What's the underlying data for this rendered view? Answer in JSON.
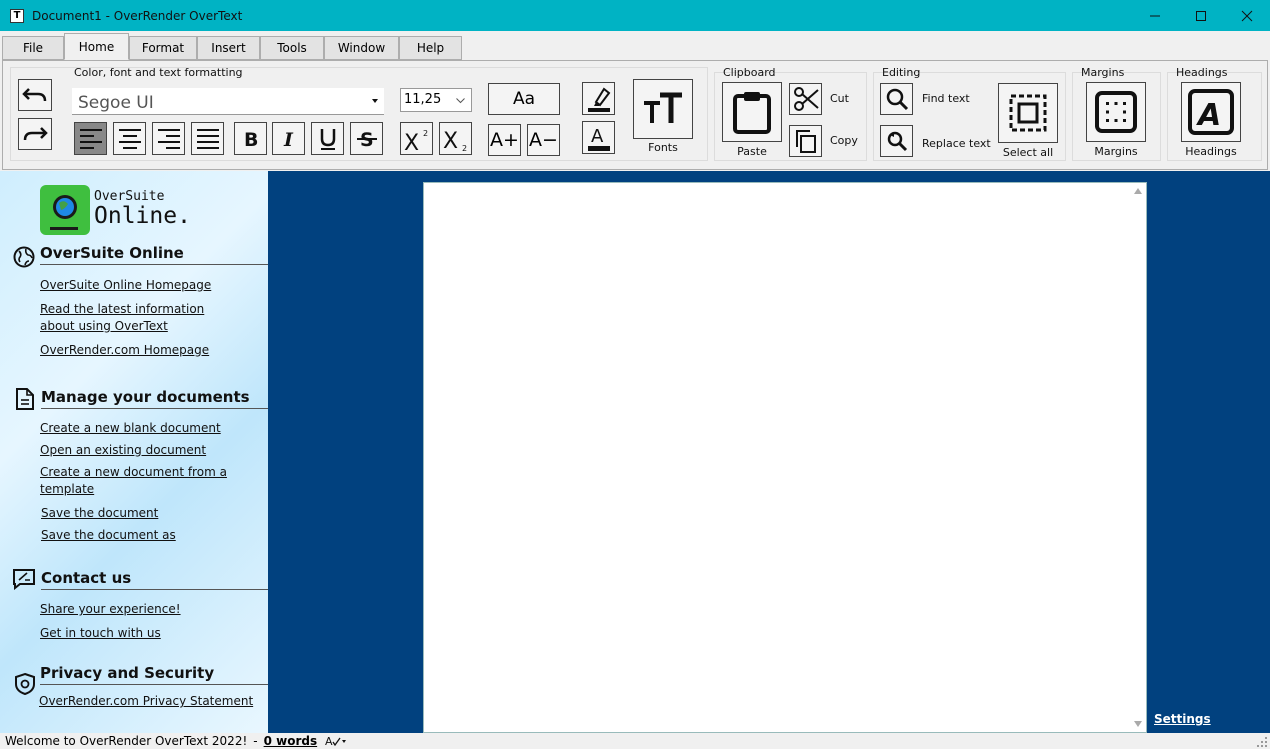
{
  "window": {
    "title": "Document1 - OverRender OverText",
    "app_icon_letter": "T"
  },
  "menu": {
    "tabs": [
      "File",
      "Home",
      "Format",
      "Insert",
      "Tools",
      "Window",
      "Help"
    ],
    "active": "Home"
  },
  "ribbon": {
    "formatting_group_title": "Color, font and text formatting",
    "font_name": "Segoe UI",
    "font_size": "11,25",
    "change_case_label": "Aa",
    "grow_font_label": "A+",
    "shrink_font_label": "A−",
    "fonts_label": "Fonts",
    "clipboard": {
      "title": "Clipboard",
      "paste": "Paste",
      "cut": "Cut",
      "copy": "Copy"
    },
    "editing": {
      "title": "Editing",
      "find": "Find text",
      "replace": "Replace text",
      "select_all": "Select all"
    },
    "margins": {
      "title": "Margins",
      "button": "Margins"
    },
    "headings": {
      "title": "Headings",
      "button": "Headings"
    }
  },
  "sidebar": {
    "logo_line1": "OverSuite",
    "logo_line2": "Online.",
    "sections": [
      {
        "heading": "OverSuite Online",
        "icon": "globe-icon",
        "links": [
          "OverSuite Online Homepage",
          "Read the latest information about using OverText",
          "OverRender.com Homepage"
        ]
      },
      {
        "heading": "Manage your documents",
        "icon": "document-icon",
        "links": [
          "Create a new blank document",
          "Open an existing document",
          "Create a new document from a template",
          "Save the document",
          "Save the document as"
        ]
      },
      {
        "heading": "Contact us",
        "icon": "feedback-icon",
        "links": [
          "Share your experience!",
          "Get in touch with us"
        ]
      },
      {
        "heading": "Privacy and Security",
        "icon": "shield-icon",
        "links": [
          "OverRender.com Privacy Statement"
        ]
      }
    ]
  },
  "workspace": {
    "settings_link": "Settings"
  },
  "statusbar": {
    "welcome": "Welcome to OverRender OverText 2022!",
    "separator": "-",
    "word_count": "0 words"
  }
}
